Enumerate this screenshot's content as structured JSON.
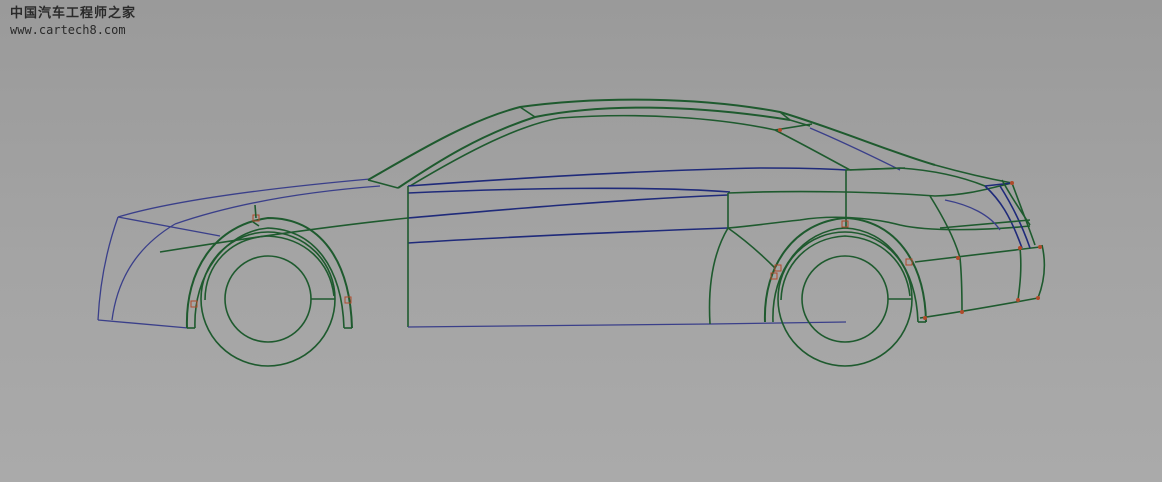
{
  "watermark": {
    "site_name": "中国汽车工程师之家",
    "url": "www.cartech8.com"
  },
  "colors": {
    "background": "#a0a0a0",
    "curve_green": "#1e5a2e",
    "curve_blue": "#3a3f8a",
    "control_point": "#b04a2a"
  }
}
